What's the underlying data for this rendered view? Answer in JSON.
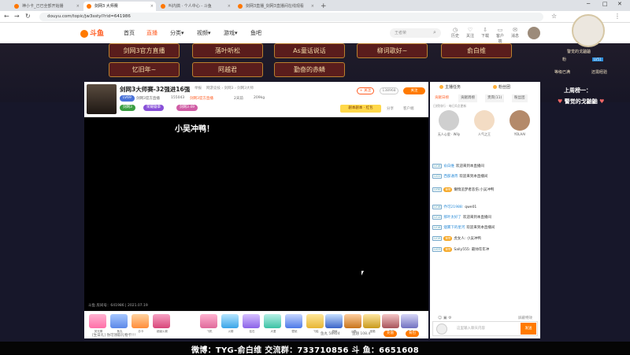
{
  "browser": {
    "tabs": [
      {
        "label": "神小卡_己已全部开始播"
      },
      {
        "label": "剑网3 大师赛"
      },
      {
        "label": "叫内搞 · 个人中心 - 斗鱼"
      },
      {
        "label": "剑网3直播_剑网3直播间在线观看"
      }
    ],
    "url": "douyu.com/topic/jw3sstyl?rid=641986"
  },
  "header": {
    "logo": "斗鱼",
    "nav": [
      "首页",
      "直播",
      "分类▾",
      "视频▾",
      "游戏▾",
      "鱼吧"
    ],
    "search_placeholder": "王者荣",
    "icons": [
      {
        "label": "历史",
        "glyph": "◷"
      },
      {
        "label": "关注",
        "glyph": "♡"
      },
      {
        "label": "下载",
        "glyph": "⇩"
      },
      {
        "label": "客户端",
        "glyph": "▭"
      },
      {
        "label": "消息",
        "glyph": "✉"
      }
    ]
  },
  "banner": {
    "pills": [
      "剑网3官方直播",
      "落叶听松",
      "As童话说话",
      "柳词歌好~",
      "俞白维",
      "忆旧年~",
      "阿越君",
      "勤奋的赤鳞"
    ]
  },
  "room": {
    "title": "剑网3大师赛-32强进16强",
    "meta": [
      "举报",
      "网游竞技 › 剑网3 › 剑网3大师"
    ],
    "sub": [
      "LV69",
      "剑网3官方直播",
      "155043",
      "2天前",
      "209kg"
    ],
    "tags": [
      "剑网3",
      "剑网3官方直播",
      "荣耀徽章",
      "剑网3 49"
    ],
    "follow": "+ 关注",
    "fans": "138968",
    "report": "关注",
    "reward": "剧本剧本 · 红包",
    "links": [
      "分享",
      "客户端",
      "爆料",
      "爆料链接"
    ]
  },
  "video": {
    "caption": "小吴冲鸭！",
    "footer": "斗鱼 房间号：641986 | 2021.07.19"
  },
  "gifts": {
    "items": [
      "荧光棒",
      "鱼丸",
      "办卡",
      "超级火箭",
      "飞机",
      "火箭",
      "钻石",
      "大爱",
      "壁纸",
      "飞船",
      "超级",
      "火箭",
      "宝箱",
      "神兽",
      "兔子"
    ],
    "info": "[生日礼] 你可领取礼物卡!!!",
    "stat1": "鱼丸 58924",
    "stat2": "鱼翅 108.4",
    "btn1": "充值",
    "btn2": "背包"
  },
  "side": {
    "tabs": [
      "主播任务",
      "粉丝团"
    ],
    "ranktabs": [
      "贡献日榜",
      "贡献周榜",
      "贵宾(11)",
      "粉丝团"
    ],
    "rankinfo": "日榜排行 · 每日0点更新",
    "ranks": [
      {
        "name": "无人心里 · Wily",
        "color": "#cfcfcf"
      },
      {
        "name": "人气之王",
        "color": "#f3dcc4"
      },
      {
        "name": "YOLAAI",
        "color": "#b48a6a"
      }
    ],
    "messages": [
      {
        "lv": "LV16",
        "user": "俞白维",
        "badge": "",
        "text": "欢迎来到本直播间"
      },
      {
        "lv": "LV22",
        "user": "西部通宵",
        "badge": "",
        "text": "欢迎来到本直播间"
      },
      {
        "lv": "LV30",
        "user": "",
        "badge": "荣誉",
        "text": "懒惰追梦者悲伤:小吴冲鸭"
      },
      {
        "lv": "LV16",
        "user": "乔可21988:",
        "badge": "",
        "text": "qwe01"
      },
      {
        "lv": "LV14",
        "user": "那叶太好了",
        "badge": "",
        "text": "欢迎来到本直播间"
      },
      {
        "lv": "LV16",
        "user": "烟雾下的星河",
        "badge": "",
        "text": "欢迎来到本直播间"
      },
      {
        "lv": "LV19",
        "user": "",
        "badge": "荣誉",
        "text": "虎女人: 小吴冲鸭"
      },
      {
        "lv": "LV23",
        "user": "",
        "badge": "荣誉",
        "text": "Sally555: 最帅年年冲"
      }
    ],
    "placeholder": "这里输入聊天内容",
    "send": "发送",
    "tool": "屏蔽特效"
  },
  "overlay": {
    "name": "警觉的戈鼬鼬",
    "sub": "粉",
    "lv": "LV51",
    "l1": "等级已满",
    "l2": "还需经验",
    "big1": "上周榜一：",
    "big2": "警觉的戈鼬鼬"
  },
  "bottom": {
    "text": "微博：TYG-俞白维   交流群：733710856   斗 鱼：6651608"
  }
}
